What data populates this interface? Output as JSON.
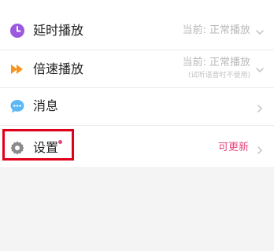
{
  "rows": {
    "delay_play": {
      "label": "延时播放",
      "value": "当前: 正常播放",
      "icon": "clock-icon",
      "icon_color": "#9b59e0"
    },
    "speed_play": {
      "label": "倍速播放",
      "value": "当前: 正常播放",
      "note": "(试听语音时不使用)",
      "icon": "fast-forward-icon",
      "icon_color": "#f7941d"
    },
    "messages": {
      "label": "消息",
      "icon": "chat-bubble-icon",
      "icon_color": "#5cb8f5"
    },
    "settings": {
      "label": "设置",
      "update_text": "可更新",
      "icon": "gear-icon",
      "icon_color": "#8a8a8a",
      "badge_color": "#e8477e"
    }
  },
  "highlight_color": "#e0001b"
}
